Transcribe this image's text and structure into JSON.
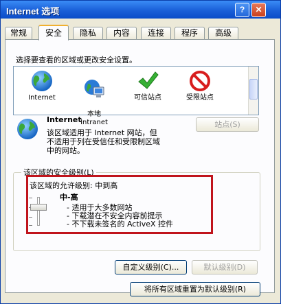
{
  "window": {
    "title": "Internet 选项",
    "help_button": "?",
    "close_button": "✕"
  },
  "tabs": [
    {
      "label": "常规"
    },
    {
      "label": "安全"
    },
    {
      "label": "隐私"
    },
    {
      "label": "内容"
    },
    {
      "label": "连接"
    },
    {
      "label": "程序"
    },
    {
      "label": "高级"
    }
  ],
  "security": {
    "instruction": "选择要查看的区域或更改安全设置。",
    "zones": [
      {
        "label": "Internet",
        "icon": "globe-icon"
      },
      {
        "label": "本地\nIntranet",
        "icon": "intranet-icon"
      },
      {
        "label": "可信站点",
        "icon": "checkmark-icon"
      },
      {
        "label": "受限站点",
        "icon": "restricted-icon"
      }
    ],
    "selected_zone": {
      "title": "Internet",
      "description_lines": [
        "该区域适用于 Internet 网站，但",
        "不适用于列在受信任和受限制区域",
        "中的网站。"
      ],
      "sites_button": "站点(S)"
    },
    "level_group": {
      "legend": "该区域的安全级别(L)",
      "allowed_level": "该区域的允许级别: 中到高",
      "level_name": "中-高",
      "bullets": [
        "- 适用于大多数网站",
        "- 下载潜在不安全内容前提示",
        "- 不下载未签名的 ActiveX 控件"
      ],
      "custom_level_button": "自定义级别(C)...",
      "default_level_button": "默认级别(D)"
    },
    "reset_all_button": "将所有区域重置为默认级别(R)"
  },
  "colors": {
    "titlebar": "#1a5fd8",
    "highlight_border": "#c0141c"
  }
}
